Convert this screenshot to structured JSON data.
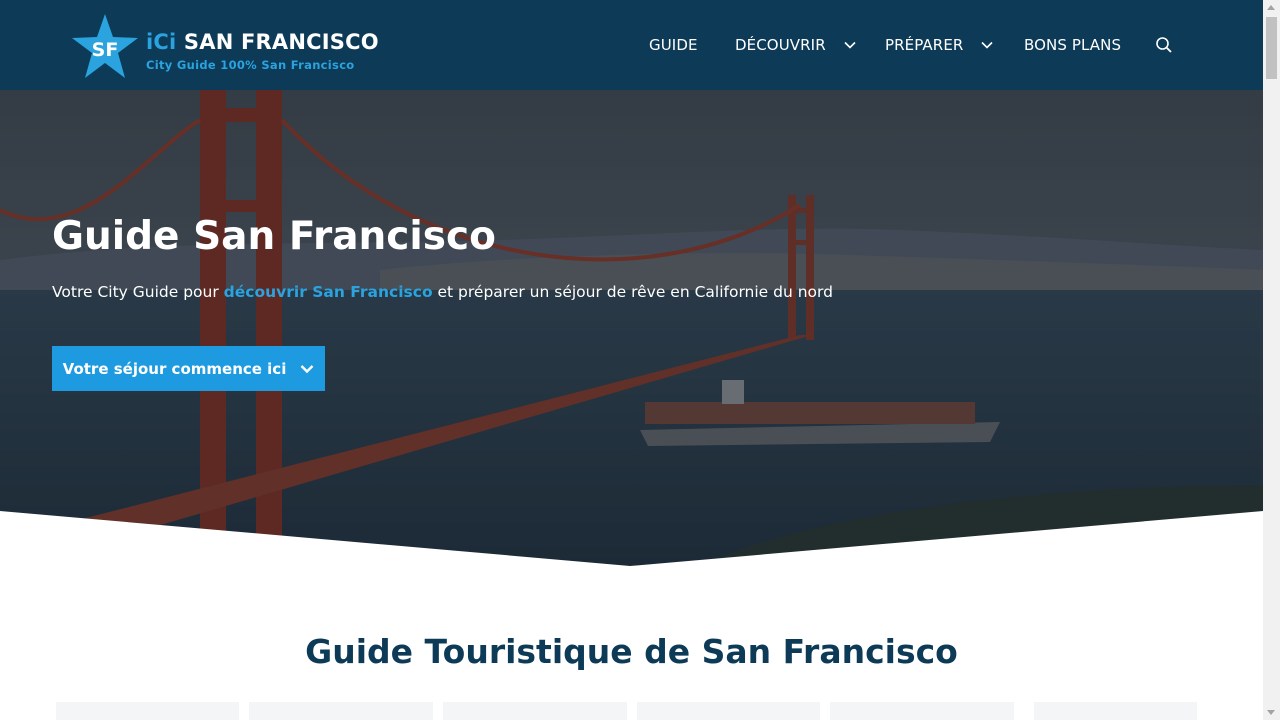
{
  "header": {
    "logo_badge": "SF",
    "logo_title_prefix": "iCi",
    "logo_title_rest": " SAN FRANCISCO",
    "logo_tagline": "City Guide 100% San Francisco",
    "background_color": "#0c3a57",
    "accent_color": "#2aa3df"
  },
  "nav": {
    "items": [
      {
        "label": "GUIDE",
        "has_dropdown": false
      },
      {
        "label": "DÉCOUVRIR",
        "has_dropdown": true
      },
      {
        "label": "PRÉPARER",
        "has_dropdown": true
      },
      {
        "label": "BONS PLANS",
        "has_dropdown": false
      }
    ],
    "search_icon": "search-icon",
    "dropdown_icon": "chevron-down-icon"
  },
  "hero": {
    "title": "Guide San Francisco",
    "subtitle_before": "Votre City Guide pour ",
    "subtitle_highlight": "découvrir San Francisco",
    "subtitle_after": " et préparer un séjour de rêve en Californie du nord",
    "button_label": "Votre séjour commence ici",
    "button_color": "#1e9be0"
  },
  "section": {
    "title": "Guide Touristique de San Francisco",
    "title_color": "#0c3a57"
  }
}
